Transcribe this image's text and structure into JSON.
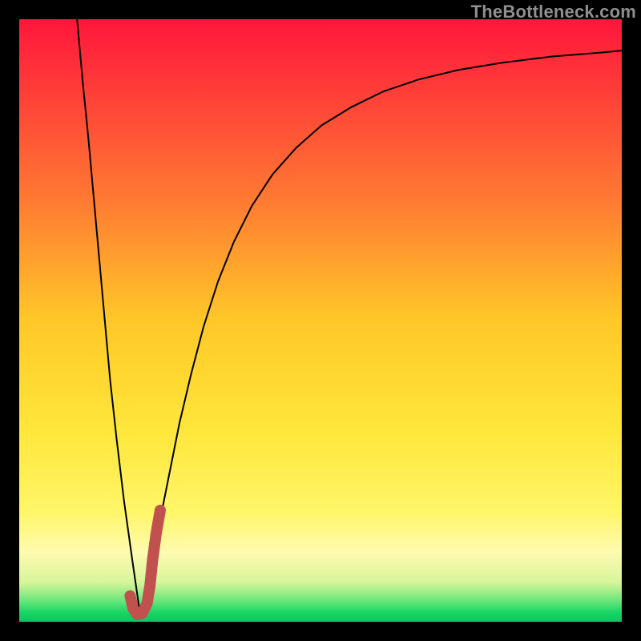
{
  "watermark": {
    "text": "TheBottleneck.com"
  },
  "chart_data": {
    "type": "line",
    "title": "",
    "xlabel": "",
    "ylabel": "",
    "xlim": [
      0,
      100
    ],
    "ylim": [
      0,
      100
    ],
    "grid": false,
    "background_gradient_stops": [
      {
        "offset": 0.0,
        "color": "#ff163c"
      },
      {
        "offset": 0.3,
        "color": "#ff7a32"
      },
      {
        "offset": 0.5,
        "color": "#ffc828"
      },
      {
        "offset": 0.68,
        "color": "#ffe63a"
      },
      {
        "offset": 0.82,
        "color": "#fff66a"
      },
      {
        "offset": 0.885,
        "color": "#fffbb0"
      },
      {
        "offset": 0.935,
        "color": "#d6f59a"
      },
      {
        "offset": 0.965,
        "color": "#6be67a"
      },
      {
        "offset": 0.985,
        "color": "#17d565"
      },
      {
        "offset": 1.0,
        "color": "#08c85c"
      }
    ],
    "series": [
      {
        "name": "bottleneck-curve",
        "stroke": "#000000",
        "stroke_width": 2,
        "x": [
          9.6,
          10.5,
          11.5,
          12.4,
          13.3,
          14.2,
          15.1,
          16.2,
          17.4,
          18.8,
          20.1,
          20.9,
          22.1,
          23.4,
          25.0,
          26.6,
          28.5,
          30.6,
          33.0,
          35.6,
          38.6,
          42.0,
          45.9,
          50.2,
          55.1,
          60.4,
          66.3,
          73.0,
          80.3,
          88.3,
          96.9,
          100.0
        ],
        "y": [
          100.0,
          90.0,
          80.0,
          70.0,
          60.0,
          50.0,
          40.0,
          30.0,
          20.0,
          10.0,
          1.0,
          4.0,
          10.0,
          17.0,
          25.0,
          33.0,
          41.0,
          49.0,
          56.5,
          63.0,
          69.0,
          74.2,
          78.6,
          82.4,
          85.4,
          88.0,
          90.0,
          91.6,
          92.8,
          93.8,
          94.5,
          94.8
        ]
      },
      {
        "name": "highlight-j",
        "stroke": "#c0514f",
        "stroke_width": 14,
        "linecap": "round",
        "x": [
          18.4,
          18.9,
          19.6,
          20.4,
          21.2,
          21.7,
          22.1,
          22.7,
          23.4
        ],
        "y": [
          4.3,
          2.2,
          1.2,
          1.4,
          3.0,
          6.0,
          10.0,
          14.5,
          18.5
        ]
      }
    ]
  }
}
